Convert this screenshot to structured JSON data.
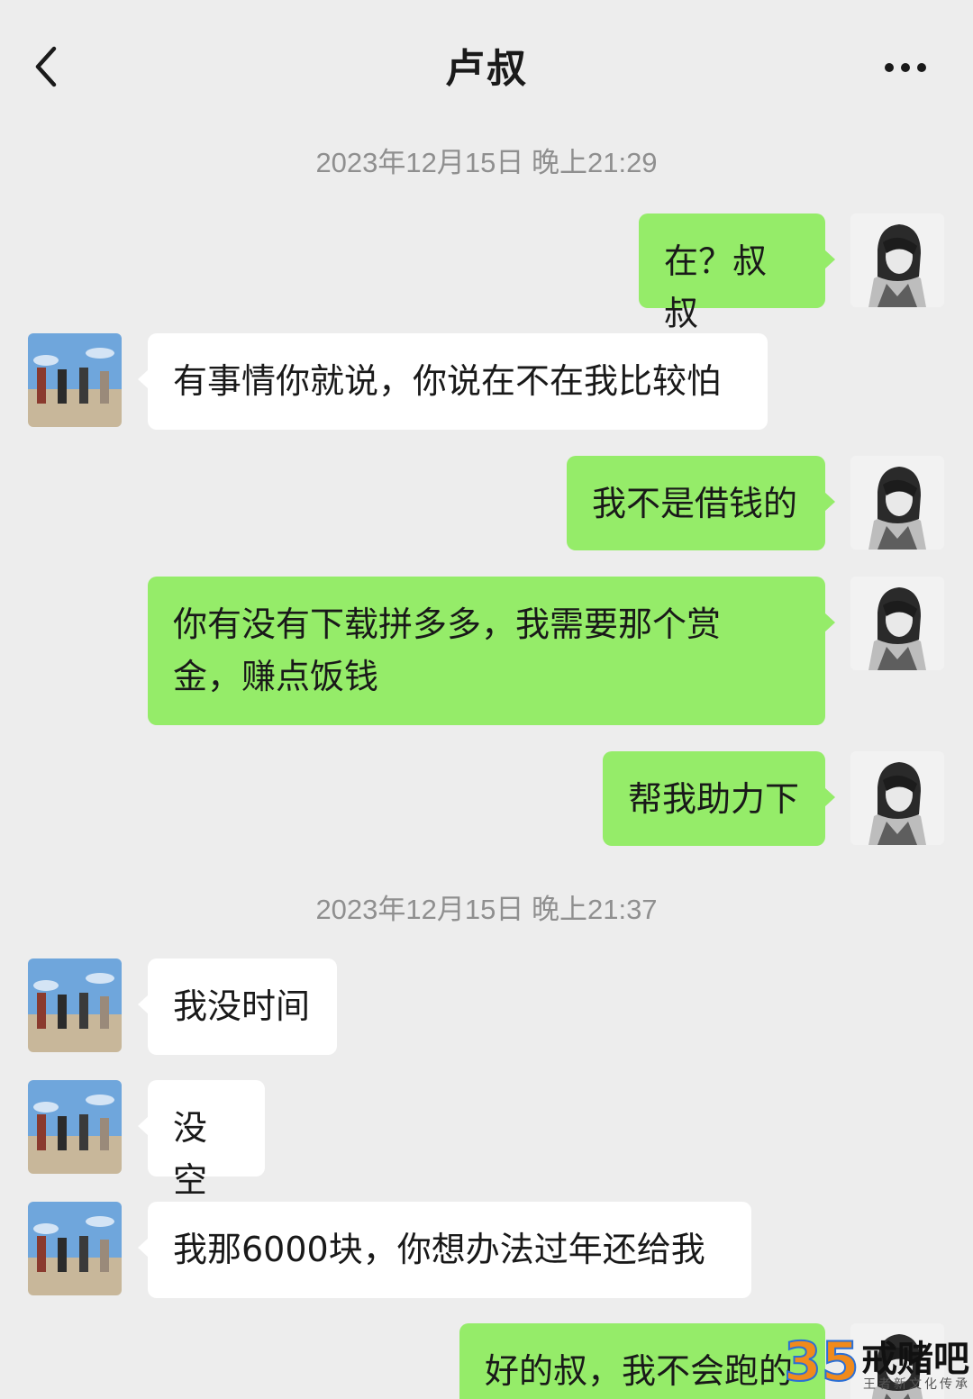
{
  "header": {
    "title": "卢叔"
  },
  "icons": {
    "back": "chevron-left-icon",
    "more": "ellipsis-icon"
  },
  "colors": {
    "background": "#ededed",
    "outgoing_bubble": "#95ec69",
    "incoming_bubble": "#ffffff",
    "timestamp_text": "#8f8f8f"
  },
  "timestamps": [
    "2023年12月15日 晚上21:29",
    "2023年12月15日 晚上21:37"
  ],
  "messages": [
    {
      "from": "me",
      "text": "在？叔叔"
    },
    {
      "from": "contact",
      "text": "有事情你就说，你说在不在我比较怕"
    },
    {
      "from": "me",
      "text": "我不是借钱的"
    },
    {
      "from": "me",
      "text": "你有没有下载拼多多，我需要那个赏金，赚点饭钱"
    },
    {
      "from": "me",
      "text": "帮我助力下"
    },
    {
      "from": "contact",
      "text": "我没时间"
    },
    {
      "from": "contact",
      "text": "没空"
    },
    {
      "from": "contact",
      "text": "我那6000块，你想办法过年还给我"
    },
    {
      "from": "me",
      "text": "好的叔，我不会跑的"
    }
  ],
  "watermark": {
    "logo_number": "35",
    "name": "戒赌吧",
    "subtitle": "王者新文化传承"
  }
}
